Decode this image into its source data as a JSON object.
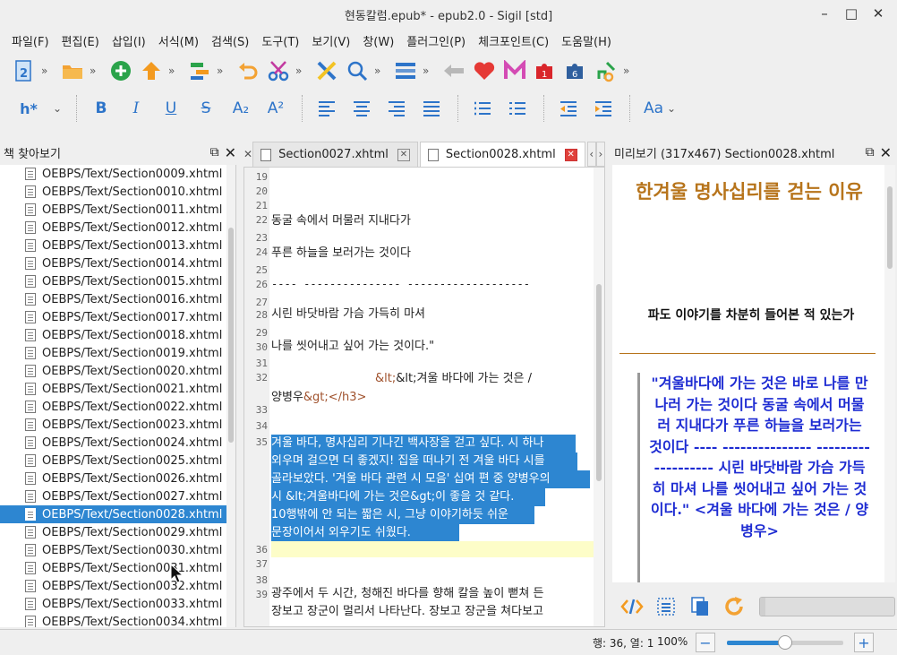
{
  "window": {
    "title": "현동칼럼.epub* - epub2.0 - Sigil [std]",
    "minimize": "–",
    "maximize": "□",
    "close": "✕"
  },
  "menu": [
    "파일(F)",
    "편집(E)",
    "삽입(I)",
    "서식(M)",
    "검색(S)",
    "도구(T)",
    "보기(V)",
    "창(W)",
    "플러그인(P)",
    "체크포인트(C)",
    "도움말(H)"
  ],
  "toolbar_icons": [
    "new-book-icon",
    "open-folder-icon",
    "add-file-icon",
    "upload-icon",
    "split-icon",
    "undo-icon",
    "cut-icon",
    "validate-icon",
    "search-icon",
    "toc-icon",
    "back-icon",
    "favorite-icon",
    "meta-icon",
    "plugin-1-icon",
    "plugin-6-icon",
    "plugin-tool-icon"
  ],
  "format": {
    "heading": "h*",
    "bold": "B",
    "italic": "I",
    "underline": "U",
    "strike": "S",
    "subscript": "A₂",
    "superscript": "A²",
    "case": "Aa"
  },
  "book_browser": {
    "title": "책 찾아보기",
    "files": [
      "OEBPS/Text/Section0009.xhtml",
      "OEBPS/Text/Section0010.xhtml",
      "OEBPS/Text/Section0011.xhtml",
      "OEBPS/Text/Section0012.xhtml",
      "OEBPS/Text/Section0013.xhtml",
      "OEBPS/Text/Section0014.xhtml",
      "OEBPS/Text/Section0015.xhtml",
      "OEBPS/Text/Section0016.xhtml",
      "OEBPS/Text/Section0017.xhtml",
      "OEBPS/Text/Section0018.xhtml",
      "OEBPS/Text/Section0019.xhtml",
      "OEBPS/Text/Section0020.xhtml",
      "OEBPS/Text/Section0021.xhtml",
      "OEBPS/Text/Section0022.xhtml",
      "OEBPS/Text/Section0023.xhtml",
      "OEBPS/Text/Section0024.xhtml",
      "OEBPS/Text/Section0025.xhtml",
      "OEBPS/Text/Section0026.xhtml",
      "OEBPS/Text/Section0027.xhtml",
      "OEBPS/Text/Section0028.xhtml",
      "OEBPS/Text/Section0029.xhtml",
      "OEBPS/Text/Section0030.xhtml",
      "OEBPS/Text/Section0031.xhtml",
      "OEBPS/Text/Section0032.xhtml",
      "OEBPS/Text/Section0033.xhtml",
      "OEBPS/Text/Section0034.xhtml"
    ],
    "selected": "OEBPS/Text/Section0028.xhtml"
  },
  "tabs": [
    {
      "label": "Section0027.xhtml",
      "active": false
    },
    {
      "label": "Section0028.xhtml",
      "active": true
    }
  ],
  "editor": {
    "line_numbers": [
      "19",
      "20",
      "21",
      "22",
      "23",
      "24",
      "25",
      "26",
      "27",
      "28",
      "29",
      "30",
      "31",
      "32",
      "33",
      "34",
      "35",
      "36",
      "37",
      "38",
      "39"
    ],
    "lines": {
      "l22": "동굴 속에서 머물러 지내다가",
      "l24": "푸른 하늘을 보러가는 것이다",
      "l26": " ---- ---------------  -------------------",
      "l28": "시린 바닷바람 가슴 가득히 마셔",
      "l30": "나를 씻어내고 싶어 가는 것이다.\"",
      "l32a": "&lt;겨울 바다에 가는 것은 /",
      "l32b_text": "양병우",
      "l32b_tag": "&gt;</h3>",
      "l35_1": "겨울 바다, 명사십리 기나긴 백사장을 걷고 싶다. 시 하나",
      "l35_2": "외우며 걸으면 더 좋겠지! 집을 떠나기 전 겨울 바다 시를",
      "l35_3": "골라보았다. '겨울 바다 관련 시 모음' 십여 편 중 양병우의",
      "l35_4": "시 &lt;겨울바다에 가는 것은&gt;이 좋을 것 같다.",
      "l35_5": "10행밖에 안 되는 짧은 시, 그냥 이야기하듯 쉬운",
      "l35_6": "문장이어서 외우기도 쉬웠다.",
      "l39_1": "광주에서 두 시간, 청해진 바다를 향해 칼을 높이 뻗쳐 든",
      "l39_2": "장보고 장군이 멀리서 나타난다. 장보고 장군을 쳐다보고"
    }
  },
  "preview": {
    "header": "미리보기 (317x467) Section0028.xhtml",
    "title": "한겨울 명사십리를 걷는 이유",
    "subtitle": "파도 이야기를 차분히 들어본 적 있는가",
    "quote": "\"겨울바다에 가는 것은 바로 나를 만나러 가는 것이다 동굴 속에서 머물러 지내다가 푸른 하늘을 보러가는 것이다 ---- --------------- ------------------- 시린 바닷바람 가슴 가득히 마셔 나를 씻어내고 싶어 가는 것이다.\" <겨울 바다에 가는 것은 / 양병우>"
  },
  "status": {
    "position": "행: 36, 열: 1",
    "zoom": "100%",
    "zoom_level": 0.5
  }
}
